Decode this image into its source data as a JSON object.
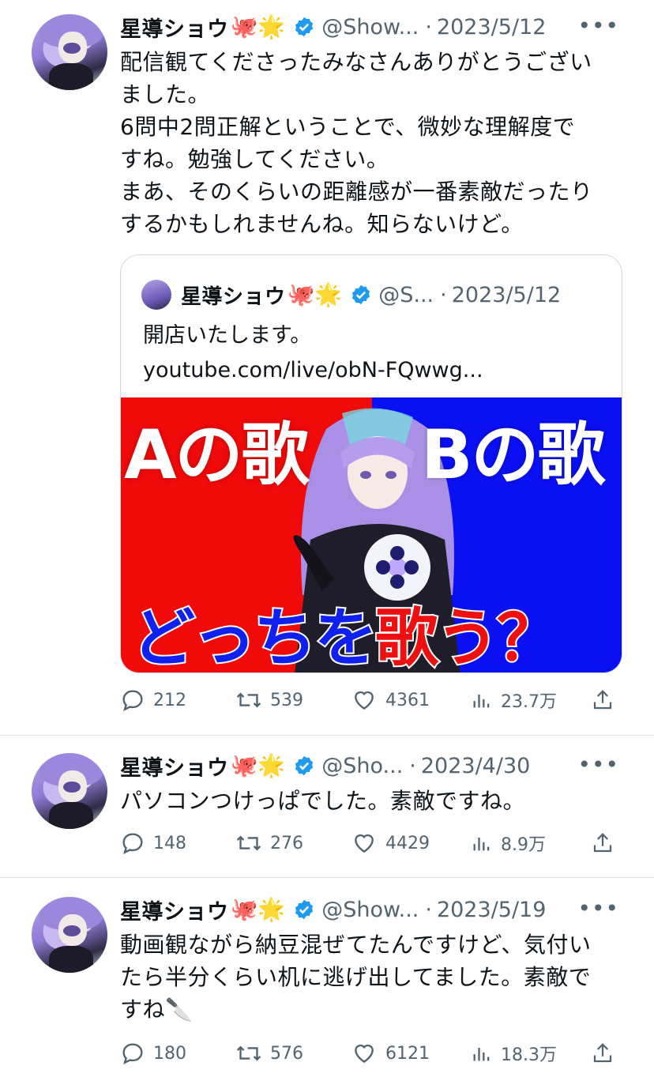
{
  "colors": {
    "accent": "#1d9bf0",
    "secondary_text": "#536471",
    "thumb_red": "#f00a0a",
    "thumb_blue": "#0a10f2"
  },
  "tweets": [
    {
      "author": "星導ショウ",
      "emojis": "🐙🌟",
      "handle": "@Show...",
      "date": "2023/5/12",
      "lines": [
        "配信観てくださったみなさんありがとうござい",
        "ました。",
        "6問中2問正解ということで、微妙な理解度で",
        "すね。勉強してください。",
        "まあ、そのくらいの距離感が一番素敵だったり",
        "するかもしれませんね。知らないけど。"
      ],
      "quote": {
        "author": "星導ショウ",
        "emojis": "🐙🌟",
        "handle": "@S...",
        "date": "2023/5/12",
        "text": "開店いたします。",
        "link": "youtube.com/live/obN-FQwwg...",
        "thumb_left": "Aの歌",
        "thumb_right": "Bの歌",
        "thumb_bottom_a": "どっちを",
        "thumb_bottom_b": "歌う？"
      },
      "replies": "212",
      "retweets": "539",
      "likes": "4361",
      "views": "23.7万"
    },
    {
      "author": "星導ショウ",
      "emojis": "🐙🌟",
      "handle": "@Sho...",
      "date": "2023/4/30",
      "lines": [
        "パソコンつけっぱでした。素敵ですね。"
      ],
      "replies": "148",
      "retweets": "276",
      "likes": "4429",
      "views": "8.9万"
    },
    {
      "author": "星導ショウ",
      "emojis": "🐙🌟",
      "handle": "@Show...",
      "date": "2023/5/19",
      "lines": [
        "動画観ながら納豆混ぜてたんですけど、気付い",
        "たら半分くらい机に逃げ出してました。素敵で",
        "すね🔪"
      ],
      "replies": "180",
      "retweets": "576",
      "likes": "6121",
      "views": "18.3万"
    }
  ],
  "icons": {
    "more": "⋯",
    "verified": "verified-badge-icon",
    "reply": "reply-icon",
    "retweet": "retweet-icon",
    "like": "heart-icon",
    "views": "views-icon",
    "share": "share-icon"
  }
}
